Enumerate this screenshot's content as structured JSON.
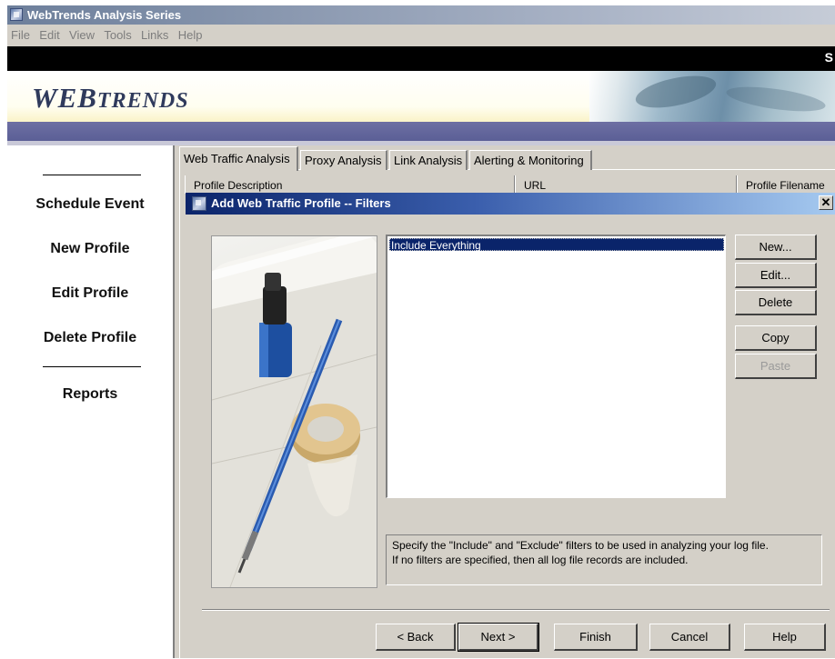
{
  "window": {
    "title": "WebTrends Analysis Series",
    "menu": [
      "File",
      "Edit",
      "View",
      "Tools",
      "Links",
      "Help"
    ],
    "blackbar_letter": "S"
  },
  "banner": {
    "logo_main": "WEB",
    "logo_sub": "TRENDS"
  },
  "sidebar": {
    "items": [
      {
        "label": "Schedule Event"
      },
      {
        "label": "New Profile"
      },
      {
        "label": "Edit Profile"
      },
      {
        "label": "Delete Profile"
      },
      {
        "label": "Reports"
      }
    ]
  },
  "tabs": [
    {
      "label": "Web Traffic Analysis",
      "active": true
    },
    {
      "label": "Proxy Analysis"
    },
    {
      "label": "Link Analysis"
    },
    {
      "label": "Alerting & Monitoring"
    }
  ],
  "profile_list": {
    "columns": [
      "Profile Description",
      "URL",
      "Profile Filename"
    ]
  },
  "dialog": {
    "title": "Add Web Traffic Profile -- Filters",
    "filters": [
      "Include Everything"
    ],
    "side_buttons": {
      "new": "New...",
      "edit": "Edit...",
      "delete": "Delete",
      "copy": "Copy",
      "paste": "Paste"
    },
    "info_line1": "Specify the \"Include\" and \"Exclude\" filters to be used in analyzing your log file.",
    "info_line2": "If no filters are specified, then all log file records are included.",
    "nav_buttons": {
      "back": "< Back",
      "next": "Next >",
      "finish": "Finish",
      "cancel": "Cancel",
      "help": "Help"
    },
    "close_glyph": "✕"
  },
  "colors": {
    "dialog_title_start": "#0b246a",
    "dialog_title_end": "#a6caf0",
    "selection": "#0a246a",
    "chrome": "#d4d0c8",
    "stripe": "#5b5f96"
  }
}
